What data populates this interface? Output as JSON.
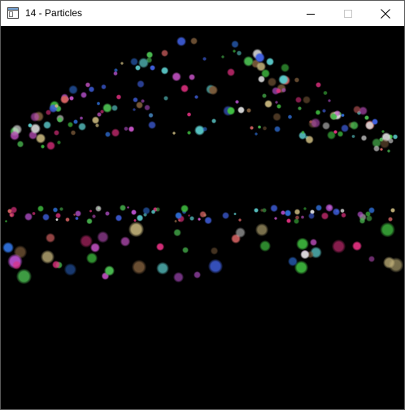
{
  "window": {
    "title": "14 - Particles",
    "icon": "app-window-icon",
    "controls": {
      "minimize_icon": "minimize-icon",
      "maximize_icon": "maximize-icon",
      "close_icon": "close-icon"
    }
  },
  "canvas": {
    "background": "#000000",
    "particle_palette": [
      "#e0307f",
      "#2f6fd8",
      "#49b84f",
      "#b24fc8",
      "#c2b27a",
      "#5ac8c8",
      "#d8d8d8",
      "#d06060",
      "#7a5a3a",
      "#40c040",
      "#4060e0",
      "#c050c0"
    ]
  }
}
